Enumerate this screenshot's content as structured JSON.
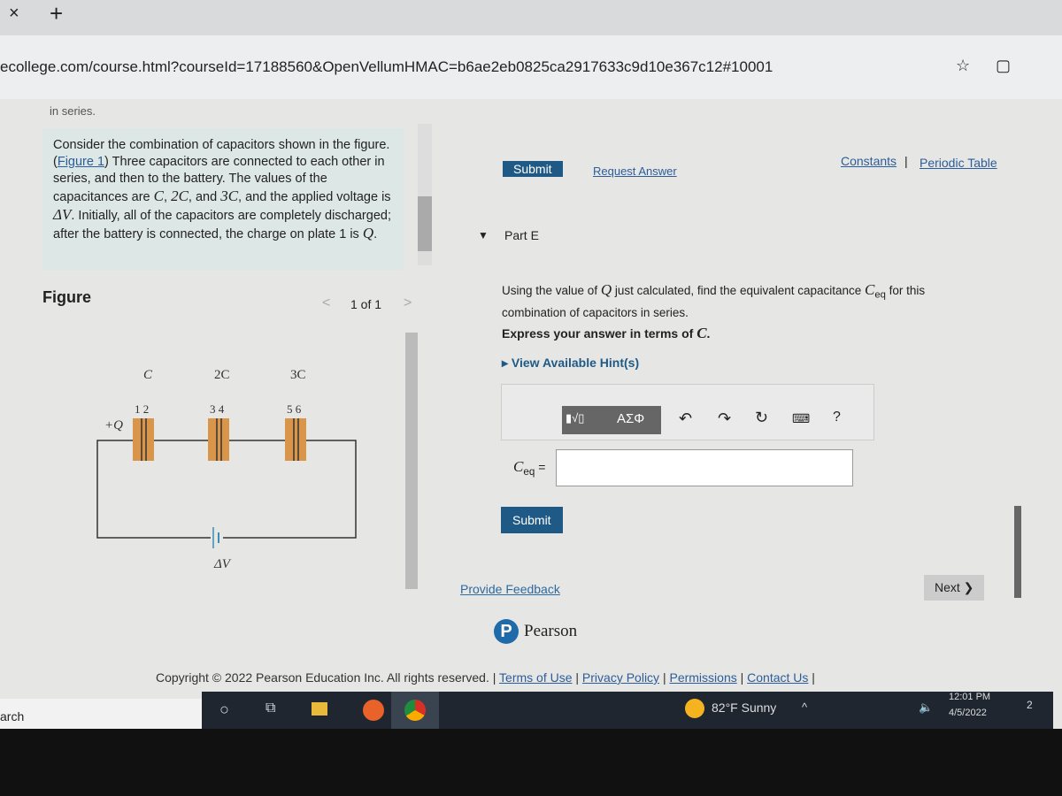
{
  "browser": {
    "close": "×",
    "new_tab": "+",
    "url": "ecollege.com/course.html?courseId=17188560&OpenVellumHMAC=b6ae2eb0825ca2917633c9d10e367c12#10001"
  },
  "problem": {
    "cut_text": "in series.",
    "text_parts": [
      "Consider the combination of capacitors shown in the figure.(",
      "Figure 1",
      ") Three capacitors are connected to each other in series, and then to the battery. The values of the capacitances are ",
      "C",
      ", ",
      "2C",
      ", and ",
      "3C",
      ", and the applied voltage is ",
      "ΔV",
      ". Initially, all of the capacitors are completely discharged; after the battery is connected, the charge on plate 1 is ",
      "Q",
      "."
    ]
  },
  "figure": {
    "title": "Figure",
    "pager": "1 of 1",
    "labels": {
      "c1": "C",
      "c2": "2C",
      "c3": "3C",
      "p12": "1  2",
      "p34": "3  4",
      "p56": "5  6",
      "q": "+Q",
      "v": "ΔV"
    },
    "plate_color": "#d9954a"
  },
  "right": {
    "submit_top": "Submit",
    "request_answer": "Request Answer",
    "constants": "Constants",
    "periodic_table": "Periodic Table",
    "sep": "|",
    "part": "Part E",
    "question_a": "Using the value of ",
    "question_q": "Q",
    "question_b": " just calculated, find the equivalent capacitance ",
    "question_c": "C",
    "question_sub": "eq",
    "question_d": " for this combination of capacitors in series.",
    "express": "Express your answer in terms of ",
    "express_c": "C",
    "hints": "View Available Hint(s)",
    "toolbar": {
      "templates": "▮√▯",
      "greek": "ΑΣΦ",
      "help": "?"
    },
    "answer_label": "C",
    "answer_sub": "eq",
    "answer_eq": "=",
    "answer_value": "",
    "submit": "Submit",
    "feedback": "Provide Feedback",
    "next": "Next ❯",
    "brand": "Pearson"
  },
  "footer": {
    "copyright": "Copyright © 2022 Pearson Education Inc. All rights reserved.",
    "links": [
      "Terms of Use",
      "Privacy Policy",
      "Permissions",
      "Contact Us"
    ]
  },
  "taskbar": {
    "search": "arch",
    "weather": "82°F  Sunny",
    "time": "12:01 PM",
    "date": "4/5/2022",
    "notif": "2"
  }
}
